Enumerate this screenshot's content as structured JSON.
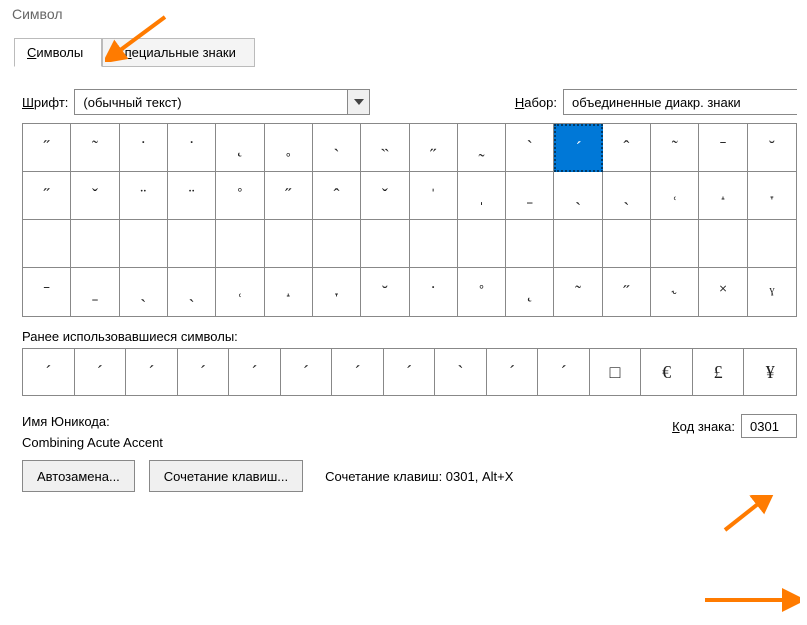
{
  "window": {
    "title": "Символ"
  },
  "tabs": {
    "symbols": "Символы",
    "special": "Специальные знаки"
  },
  "font": {
    "label": "Шрифт:",
    "value": "(обычный текст)"
  },
  "set": {
    "label": "Набор:",
    "value": "объединенные диакр. знаки"
  },
  "grid": {
    "rows": [
      [
        "˝",
        "˜",
        "˙",
        "˙",
        "˛",
        "˳",
        "˴",
        "˵",
        "˶",
        "˷",
        "`",
        "´",
        "ˆ",
        "˜",
        "ˉ",
        "˘"
      ],
      [
        "˝",
        "ˇ",
        "¨",
        "¨",
        "˚",
        "˝",
        "ˆ",
        "ˇ",
        "ˈ",
        "ˌ",
        "ˍ",
        "ˎ",
        "ˏ",
        "˓",
        "˔",
        "˕"
      ],
      [
        "",
        "",
        "",
        "",
        "",
        "",
        "",
        "",
        "",
        "",
        "",
        "",
        "",
        "",
        "",
        ""
      ],
      [
        "ˉ",
        "ˍ",
        "ˎ",
        "ˏ",
        "˓",
        "˔",
        "˕",
        "˘",
        "˙",
        "˚",
        "˛",
        "˜",
        "˝",
        "˞",
        "˟",
        "ˠ"
      ]
    ],
    "selected": {
      "row": 0,
      "col": 11
    }
  },
  "recent_label": "Ранее использовавшиеся символы:",
  "recent": [
    "´",
    "´",
    "´",
    "´",
    "´",
    "´",
    "´",
    "´",
    "`",
    "´",
    "´",
    "□",
    "€",
    "£",
    "¥"
  ],
  "unicode_name_label": "Имя Юникода:",
  "unicode_name": "Combining Acute Accent",
  "char_code_label": "Код знака:",
  "char_code": "0301",
  "btn_autocorrect": "Автозамена...",
  "btn_shortcut": "Сочетание клавиш...",
  "shortcut_label": "Сочетание клавиш: 0301, Alt+X"
}
